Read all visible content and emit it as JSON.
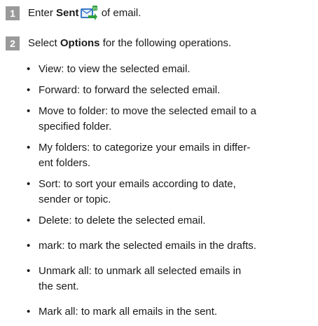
{
  "steps": [
    {
      "number": "1",
      "pre": "Enter ",
      "bold": "Sent",
      "post": " of email.",
      "icon": "sent-mailbox-icon"
    },
    {
      "number": "2",
      "pre": "Select ",
      "bold": "Options",
      "post": " for the following operations."
    }
  ],
  "bullet_marker": "•",
  "bullets": [
    {
      "text": "View: to view the selected email."
    },
    {
      "text": "Forward: to forward the selected email."
    },
    {
      "line1": "Move to folder: to move the selected email to a",
      "line2": "specified folder."
    },
    {
      "line1": "My folders: to categorize your emails in differ-",
      "line2": "ent folders."
    },
    {
      "line1": "Sort: to sort your emails according to date,",
      "line2": "sender or topic."
    },
    {
      "text": "Delete: to delete the selected email."
    },
    {
      "text": "mark: to mark the selected emails in the drafts."
    },
    {
      "line1": "Unmark all: to unmark all selected emails in",
      "line2": "the sent."
    },
    {
      "text": "Mark all: to mark all emails in the sent."
    }
  ],
  "colors": {
    "step_badge": "#9a9a9a",
    "icon_green": "#2e9f3a",
    "icon_blue": "#3a78c8"
  }
}
